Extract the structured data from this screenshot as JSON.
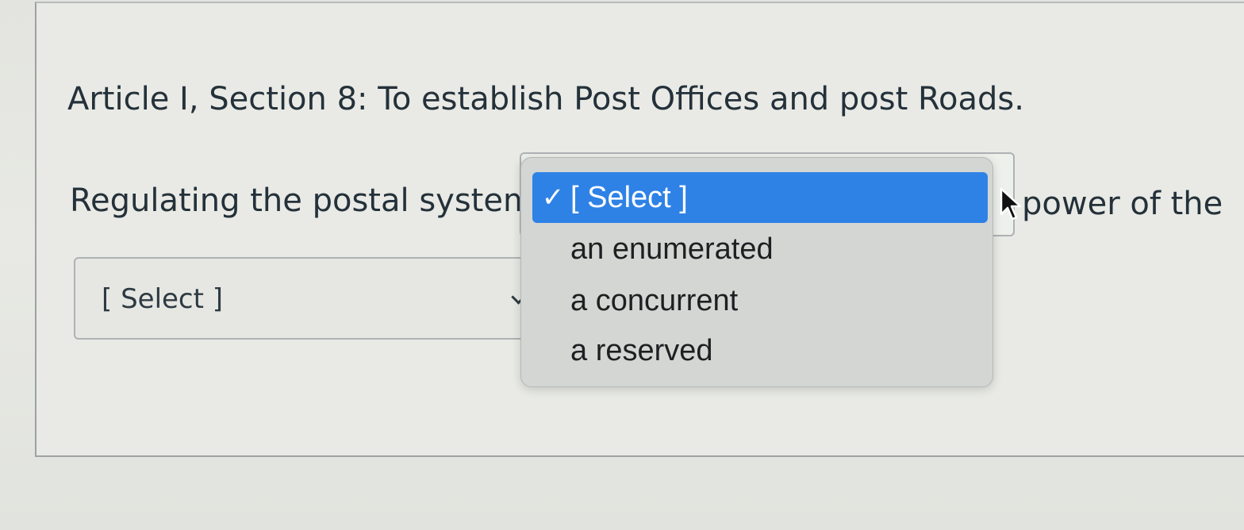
{
  "question": {
    "article": "Article I, Section 8: To establish Post Offices and post Roads.",
    "sentence_before": "Regulating the postal system is",
    "sentence_after": "power of the",
    "first_select": {
      "value": "[ Select ]",
      "options": [
        {
          "check": "✓",
          "label": "[ Select ]",
          "selected": true
        },
        {
          "check": "",
          "label": "an enumerated",
          "selected": false
        },
        {
          "check": "",
          "label": "a concurrent",
          "selected": false
        },
        {
          "check": "",
          "label": "a reserved",
          "selected": false
        }
      ]
    },
    "second_select": {
      "value": "[ Select ]"
    }
  },
  "colors": {
    "selection_highlight": "#2e82e6",
    "card_border": "#9ea2a3",
    "text": "#24313a"
  },
  "icons": {
    "checkmark": "checkmark-icon",
    "chevron": "chevron-down-icon",
    "pointer": "mouse-pointer-icon"
  }
}
